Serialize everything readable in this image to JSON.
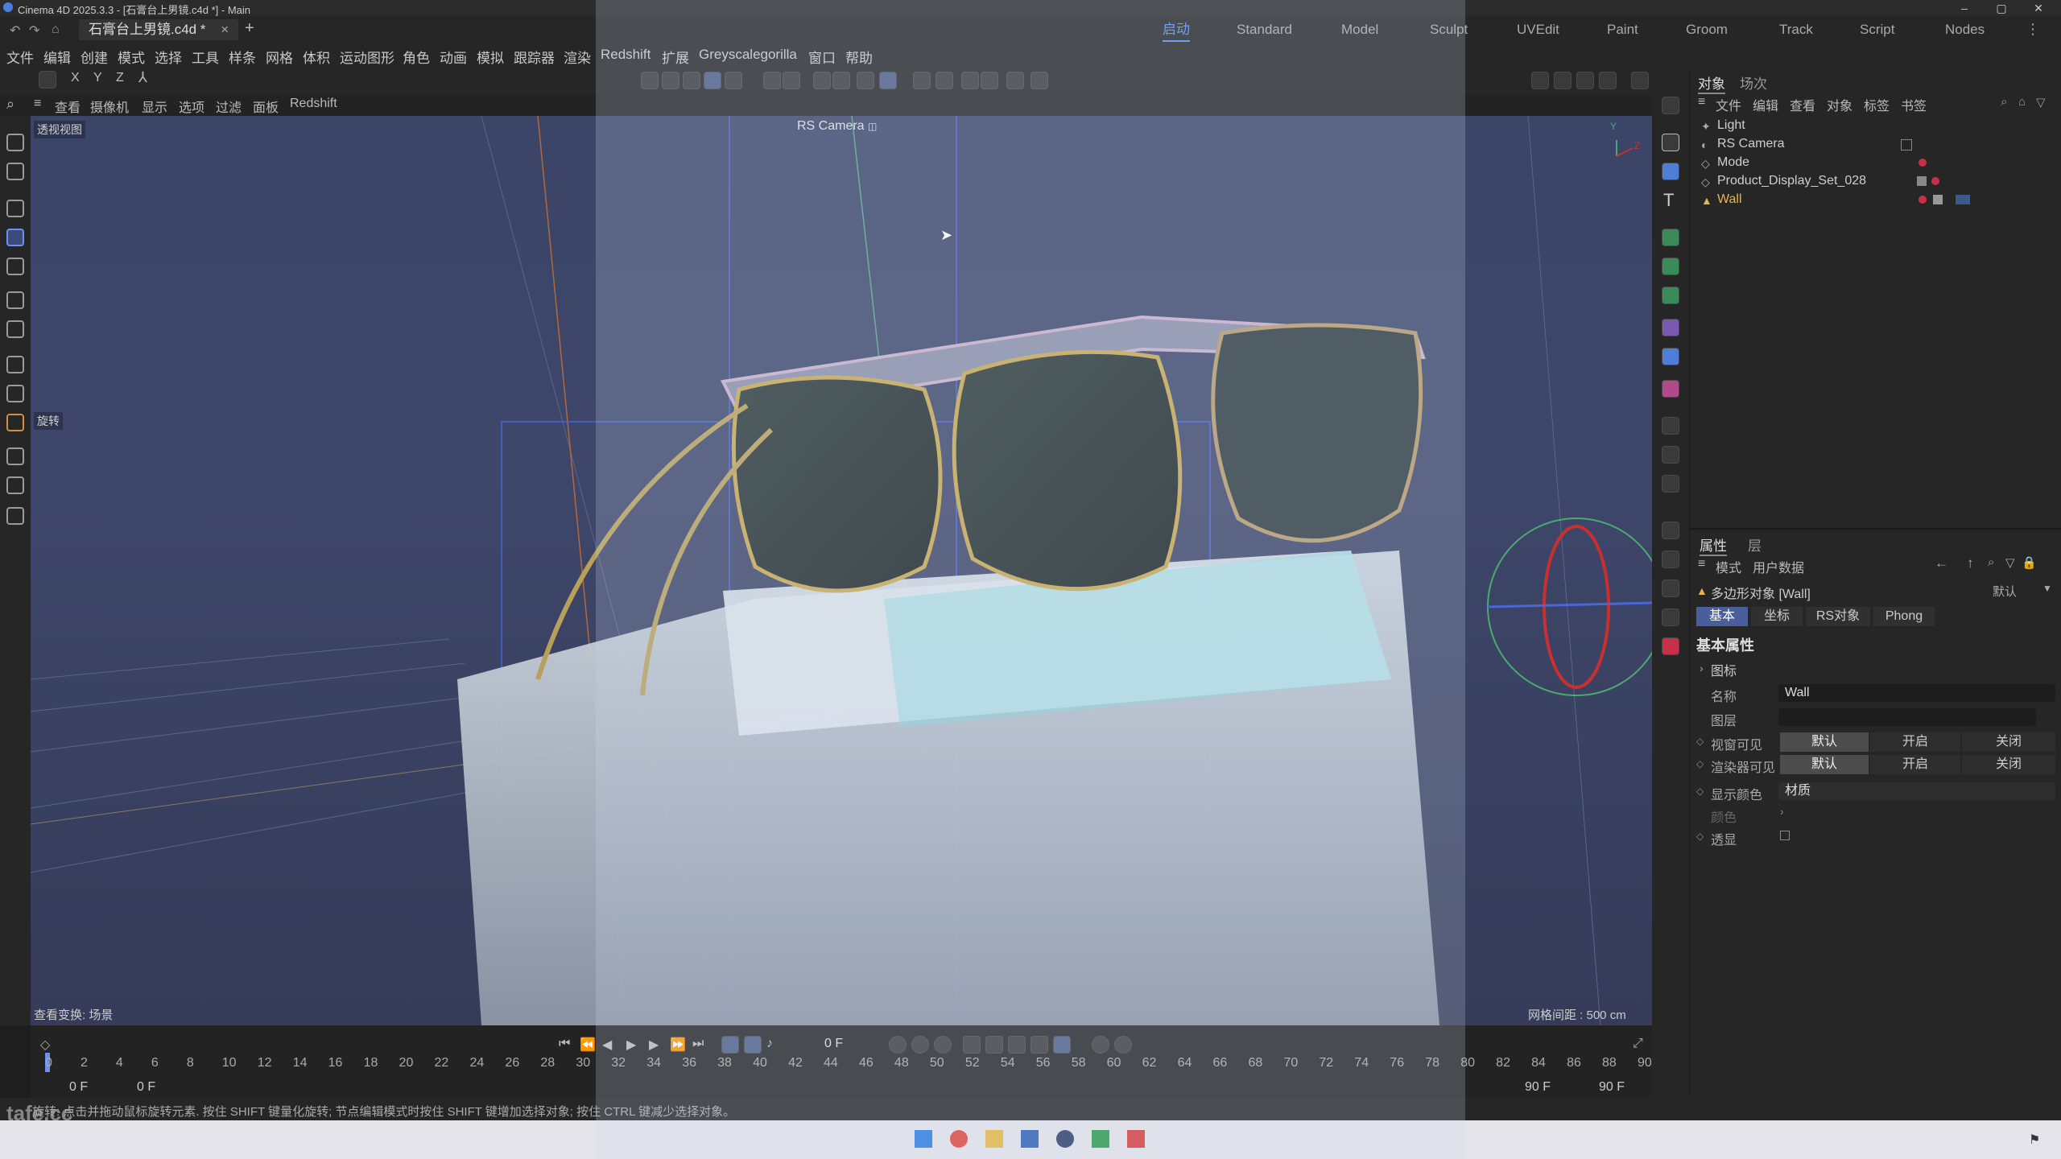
{
  "window": {
    "title": "Cinema 4D 2025.3.3 - [石膏台上男镜.c4d *] - Main",
    "min": "–",
    "max": "▢",
    "close": "✕"
  },
  "tabs": {
    "doc_tab": "石膏台上男镜.c4d *",
    "close": "×",
    "new_tab": "+",
    "layouts": [
      "启动",
      "Standard",
      "Model",
      "Sculpt",
      "UVEdit",
      "Paint",
      "Groom",
      "Track",
      "Script",
      "Nodes"
    ]
  },
  "menu": [
    "文件",
    "编辑",
    "创建",
    "模式",
    "选择",
    "工具",
    "样条",
    "网格",
    "体积",
    "运动图形",
    "角色",
    "动画",
    "模拟",
    "跟踪器",
    "渲染",
    "Redshift",
    "扩展",
    "Greyscalegorilla",
    "窗口",
    "帮助"
  ],
  "axis_toggles": [
    "X",
    "Y",
    "Z"
  ],
  "viewport_menu": [
    "查看",
    "摄像机",
    "显示",
    "选项",
    "过滤",
    "面板",
    "Redshift"
  ],
  "viewport": {
    "view_name": "透视视图",
    "camera_label": "RS Camera",
    "tool_label": "旋转",
    "view_transform": "查看变换: 场景",
    "grid_spacing": "网格间距 : 500 cm",
    "axis_y": "Y",
    "axis_z": "Z"
  },
  "object_manager": {
    "tabs": [
      "对象",
      "场次"
    ],
    "menu": [
      "文件",
      "编辑",
      "查看",
      "对象",
      "标签",
      "书签"
    ],
    "objects": [
      {
        "name": "Light",
        "color": "#cfcfcf"
      },
      {
        "name": "RS Camera",
        "color": "#cfcfcf"
      },
      {
        "name": "Mode",
        "color": "#cfcfcf"
      },
      {
        "name": "Product_Display_Set_028",
        "color": "#cfcfcf"
      },
      {
        "name": "Wall",
        "color": "#e8b64a"
      }
    ]
  },
  "attributes": {
    "tabs": [
      "属性",
      "层"
    ],
    "menu": [
      "模式",
      "用户数据"
    ],
    "object_title": "多边形对象 [Wall]",
    "preset": "默认",
    "subtabs": [
      "基本",
      "坐标",
      "RS对象",
      "Phong"
    ],
    "section": "基本属性",
    "group": "图标",
    "rows": {
      "name_label": "名称",
      "name_value": "Wall",
      "layer_label": "图层",
      "viewport_vis_label": "视窗可见",
      "render_vis_label": "渲染器可见",
      "opt_default": "默认",
      "opt_on": "开启",
      "opt_off": "关闭",
      "display_color_label": "显示颜色",
      "display_color_value": "材质",
      "color_label": "颜色",
      "xray_label": "透显"
    }
  },
  "timeline": {
    "current_frame": "0 F",
    "ticks": [
      "0",
      "2",
      "4",
      "6",
      "8",
      "10",
      "12",
      "14",
      "16",
      "18",
      "20",
      "22",
      "24",
      "26",
      "28",
      "30",
      "32",
      "34",
      "36",
      "38",
      "40",
      "42",
      "44",
      "46",
      "48",
      "50",
      "52",
      "54",
      "56",
      "58",
      "60",
      "62",
      "64",
      "66",
      "68",
      "70",
      "72",
      "74",
      "76",
      "78",
      "80",
      "82",
      "84",
      "86",
      "88",
      "90"
    ],
    "start": "0 F",
    "start2": "0 F",
    "end": "90 F",
    "end2": "90 F"
  },
  "status": {
    "text": "旋转: 点击并拖动鼠标旋转元素. 按住 SHIFT 键量化旋转; 节点编辑模式时按住 SHIFT 键增加选择对象; 按住 CTRL 键减少选择对象。",
    "watermark": "tafe.cc"
  },
  "colors": {
    "accent": "#5d8ef0",
    "wall_selected": "#e8b64a"
  }
}
